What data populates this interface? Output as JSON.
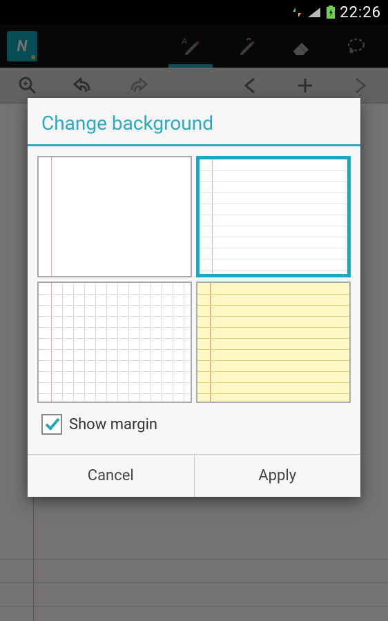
{
  "status": {
    "clock": "22:26"
  },
  "dialog": {
    "title": "Change background",
    "options": [
      "blank",
      "ruled",
      "grid",
      "ruled-yellow"
    ],
    "selected_index": 1,
    "show_margin_label": "Show margin",
    "show_margin_checked": true,
    "buttons": {
      "cancel": "Cancel",
      "apply": "Apply"
    }
  },
  "colors": {
    "accent": "#1aa9c4"
  }
}
